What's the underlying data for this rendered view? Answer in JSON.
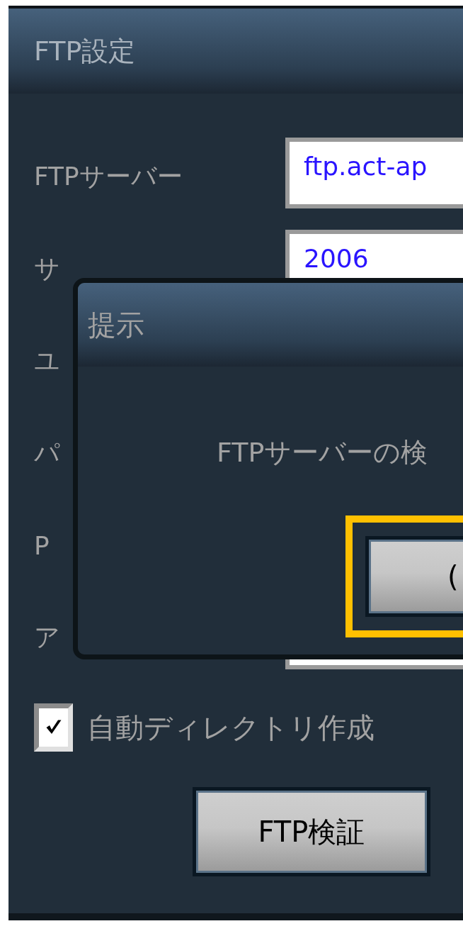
{
  "settings_window": {
    "title": "FTP設定",
    "fields": [
      {
        "label": "FTPサーバー",
        "value": "ftp.act-ap"
      },
      {
        "label": "サ",
        "value": "2006"
      },
      {
        "label": "ユ"
      },
      {
        "label": "パ"
      },
      {
        "label": "P"
      },
      {
        "label": "ア"
      }
    ],
    "auto_directory": {
      "label": "自動ディレクトリ作成",
      "checked": true
    },
    "verify_button": "FTP検証"
  },
  "dialog": {
    "title": "提示",
    "message": "FTPサーバーの検",
    "button": "("
  }
}
